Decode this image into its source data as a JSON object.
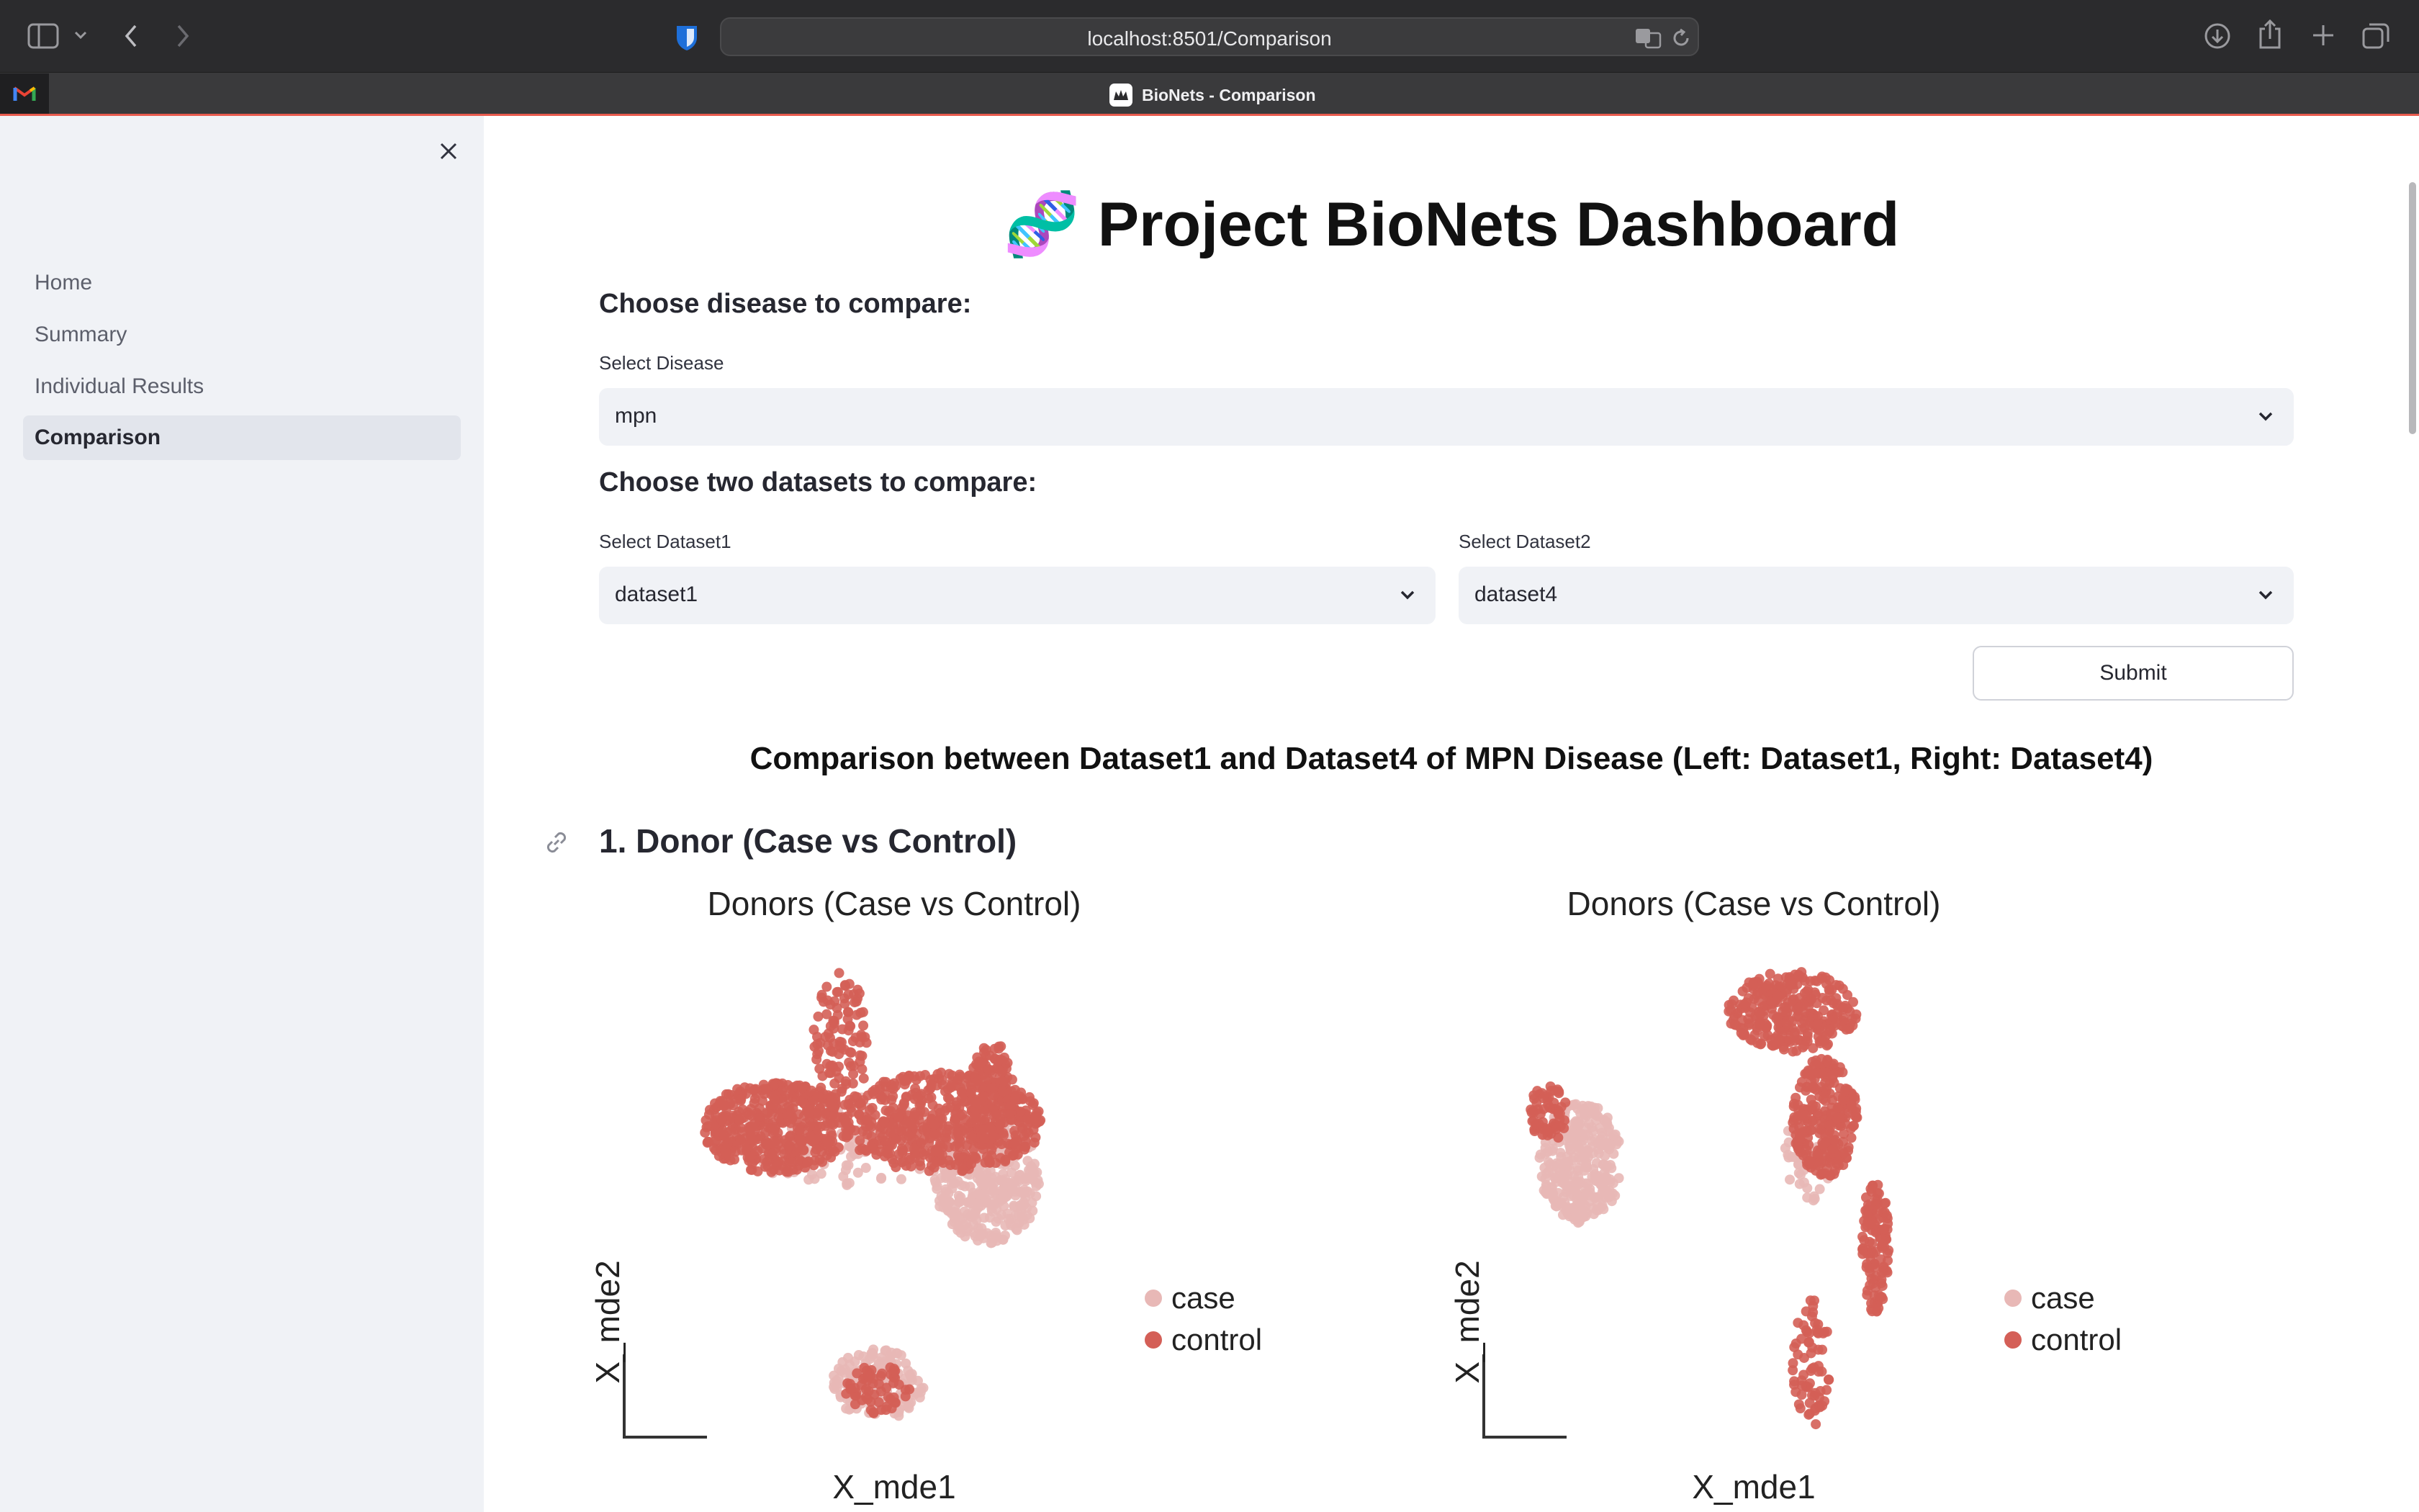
{
  "browser": {
    "url": "localhost:8501/Comparison",
    "tab_title": "BioNets - Comparison",
    "icons": [
      "sidebar-toggle-icon",
      "chevron-down-icon",
      "back-icon",
      "forward-icon",
      "bitwarden-icon",
      "translate-icon",
      "reload-icon",
      "download-icon",
      "share-icon",
      "new-tab-icon",
      "tabs-overview-icon",
      "gmail-icon"
    ]
  },
  "sidebar": {
    "close_icon": "close-icon",
    "items": [
      {
        "label": "Home"
      },
      {
        "label": "Summary"
      },
      {
        "label": "Individual Results"
      },
      {
        "label": "Comparison",
        "active": true
      }
    ]
  },
  "main": {
    "title_emoji": "🧬",
    "title": "Project BioNets Dashboard",
    "disease_section": "Choose disease to compare:",
    "select_disease_label": "Select Disease",
    "select_disease_value": "mpn",
    "datasets_section": "Choose two datasets to compare:",
    "dataset1_label": "Select Dataset1",
    "dataset1_value": "dataset1",
    "dataset2_label": "Select Dataset2",
    "dataset2_value": "dataset4",
    "submit_label": "Submit",
    "comparison_title": "Comparison between Dataset1 and Dataset4 of MPN Disease (Left: Dataset1, Right: Dataset4)",
    "section1_heading": "1. Donor (Case vs Control)",
    "link_icon": "link-icon"
  },
  "colors": {
    "case": "#e8b8b6",
    "control": "#d45f57",
    "sidebar_bg": "#f0f2f6"
  },
  "chart_data": [
    {
      "type": "scatter",
      "title": "Donors (Case vs Control)",
      "xlabel": "X_mde1",
      "ylabel": "X_mde2",
      "legend": [
        "case",
        "control"
      ],
      "legend_position": "right",
      "grid": false,
      "series": [
        {
          "name": "case",
          "clusters": [
            {
              "cx": 0.72,
              "cy": 0.55,
              "rx": 0.12,
              "ry": 0.13,
              "n": 380
            },
            {
              "cx": 0.48,
              "cy": 0.14,
              "rx": 0.1,
              "ry": 0.07,
              "n": 150
            },
            {
              "cx": 0.42,
              "cy": 0.62,
              "rx": 0.25,
              "ry": 0.09,
              "n": 110
            }
          ]
        },
        {
          "name": "control",
          "clusters": [
            {
              "cx": 0.26,
              "cy": 0.65,
              "rx": 0.16,
              "ry": 0.09,
              "n": 460
            },
            {
              "cx": 0.62,
              "cy": 0.66,
              "rx": 0.22,
              "ry": 0.1,
              "n": 520
            },
            {
              "cx": 0.4,
              "cy": 0.82,
              "rx": 0.06,
              "ry": 0.14,
              "n": 110
            },
            {
              "cx": 0.48,
              "cy": 0.13,
              "rx": 0.07,
              "ry": 0.05,
              "n": 60
            },
            {
              "cx": 0.73,
              "cy": 0.72,
              "rx": 0.05,
              "ry": 0.1,
              "n": 120
            }
          ]
        }
      ]
    },
    {
      "type": "scatter",
      "title": "Donors (Case vs Control)",
      "xlabel": "X_mde1",
      "ylabel": "X_mde2",
      "legend": [
        "case",
        "control"
      ],
      "legend_position": "right",
      "grid": false,
      "series": [
        {
          "name": "case",
          "clusters": [
            {
              "cx": 0.14,
              "cy": 0.58,
              "rx": 0.09,
              "ry": 0.12,
              "n": 320
            },
            {
              "cx": 0.64,
              "cy": 0.6,
              "rx": 0.06,
              "ry": 0.1,
              "n": 50
            }
          ]
        },
        {
          "name": "control",
          "clusters": [
            {
              "cx": 0.6,
              "cy": 0.88,
              "rx": 0.14,
              "ry": 0.08,
              "n": 300
            },
            {
              "cx": 0.67,
              "cy": 0.67,
              "rx": 0.07,
              "ry": 0.12,
              "n": 260
            },
            {
              "cx": 0.78,
              "cy": 0.42,
              "rx": 0.03,
              "ry": 0.14,
              "n": 120
            },
            {
              "cx": 0.64,
              "cy": 0.18,
              "rx": 0.04,
              "ry": 0.13,
              "n": 70
            },
            {
              "cx": 0.07,
              "cy": 0.68,
              "rx": 0.04,
              "ry": 0.06,
              "n": 60
            }
          ]
        }
      ]
    }
  ]
}
